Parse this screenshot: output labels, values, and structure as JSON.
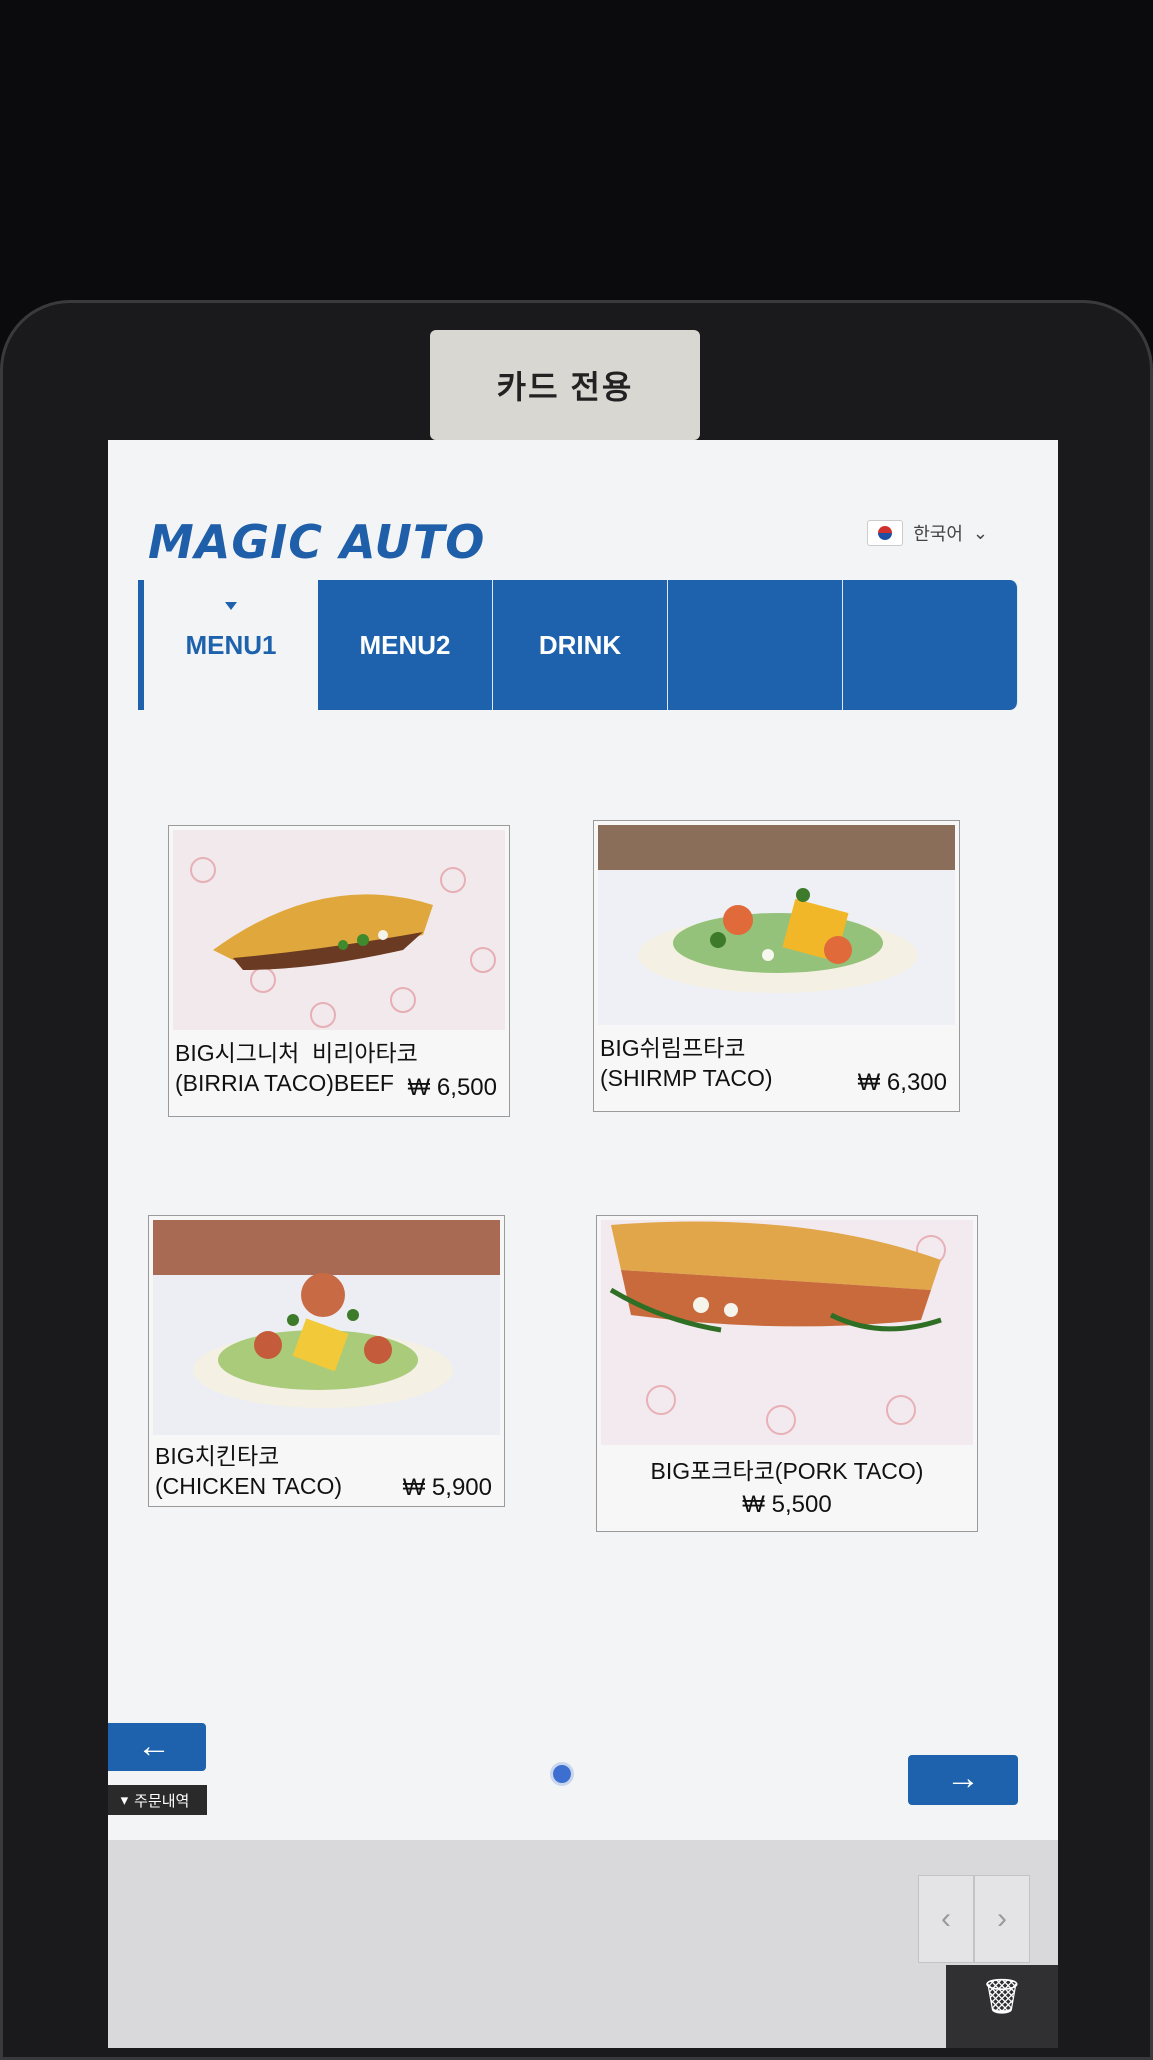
{
  "device": {
    "card_label": "카드 전용"
  },
  "header": {
    "logo": "MAGIC AUTO",
    "language": {
      "label": "한국어",
      "icon": "korea-flag-icon"
    }
  },
  "tabs": [
    {
      "label": "MENU1",
      "active": true
    },
    {
      "label": "MENU2",
      "active": false
    },
    {
      "label": "DRINK",
      "active": false
    },
    {
      "label": "",
      "active": false
    },
    {
      "label": "",
      "active": false
    }
  ],
  "menu_items": [
    {
      "name": "BIG시그니처  비리아타코\n(BIRRIA TACO)BEEF",
      "price": "₩ 6,500"
    },
    {
      "name": "BIG쉬림프타코\n(SHIRMP TACO)",
      "price": "₩ 6,300"
    },
    {
      "name": "BIG치킨타코\n(CHICKEN TACO)",
      "price": "₩ 5,900"
    },
    {
      "name": "BIG포크타코(PORK TACO)",
      "price": "₩ 5,500"
    }
  ],
  "navigation": {
    "prev_icon": "←",
    "next_icon": "→",
    "order_history_label": "주문내역",
    "tray_prev": "‹",
    "tray_next": "›"
  },
  "colors": {
    "brand": "#1e62ad",
    "background": "#f3f4f5"
  }
}
